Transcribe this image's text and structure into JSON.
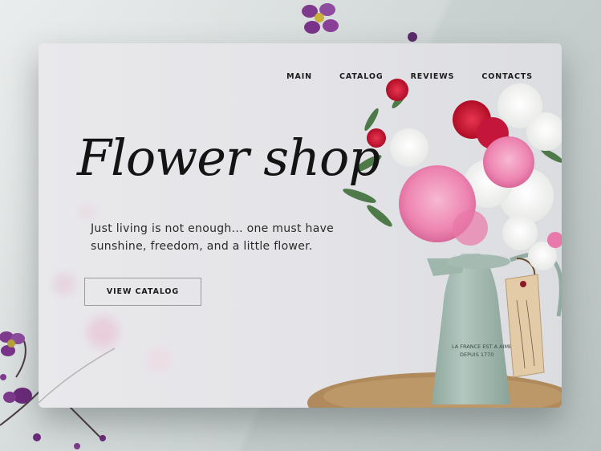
{
  "nav": {
    "items": [
      {
        "label": "MAIN"
      },
      {
        "label": "CATALOG"
      },
      {
        "label": "REVIEWS"
      },
      {
        "label": "CONTACTS"
      }
    ]
  },
  "hero": {
    "title": "Flower shop",
    "tagline": "Just living is not enough... one must have sunshine, freedom, and a little flower.",
    "cta_label": "VIEW CATALOG"
  },
  "photo": {
    "jug_text_line1": "LA FRANCE EST A AIMER",
    "jug_text_line2": "DEPUIS 1770"
  },
  "colors": {
    "page_background": "#c9d1d0",
    "card_background": "#e6e6ea",
    "text": "#141414",
    "jug": "#9fb6ac",
    "peony": "#f08bb4",
    "carnation": "#c8102e",
    "burlap": "#b08a5c",
    "wildflower": "#7e3a8c"
  },
  "icons": [
    "bouquet-illustration",
    "wildflower-sprig"
  ]
}
